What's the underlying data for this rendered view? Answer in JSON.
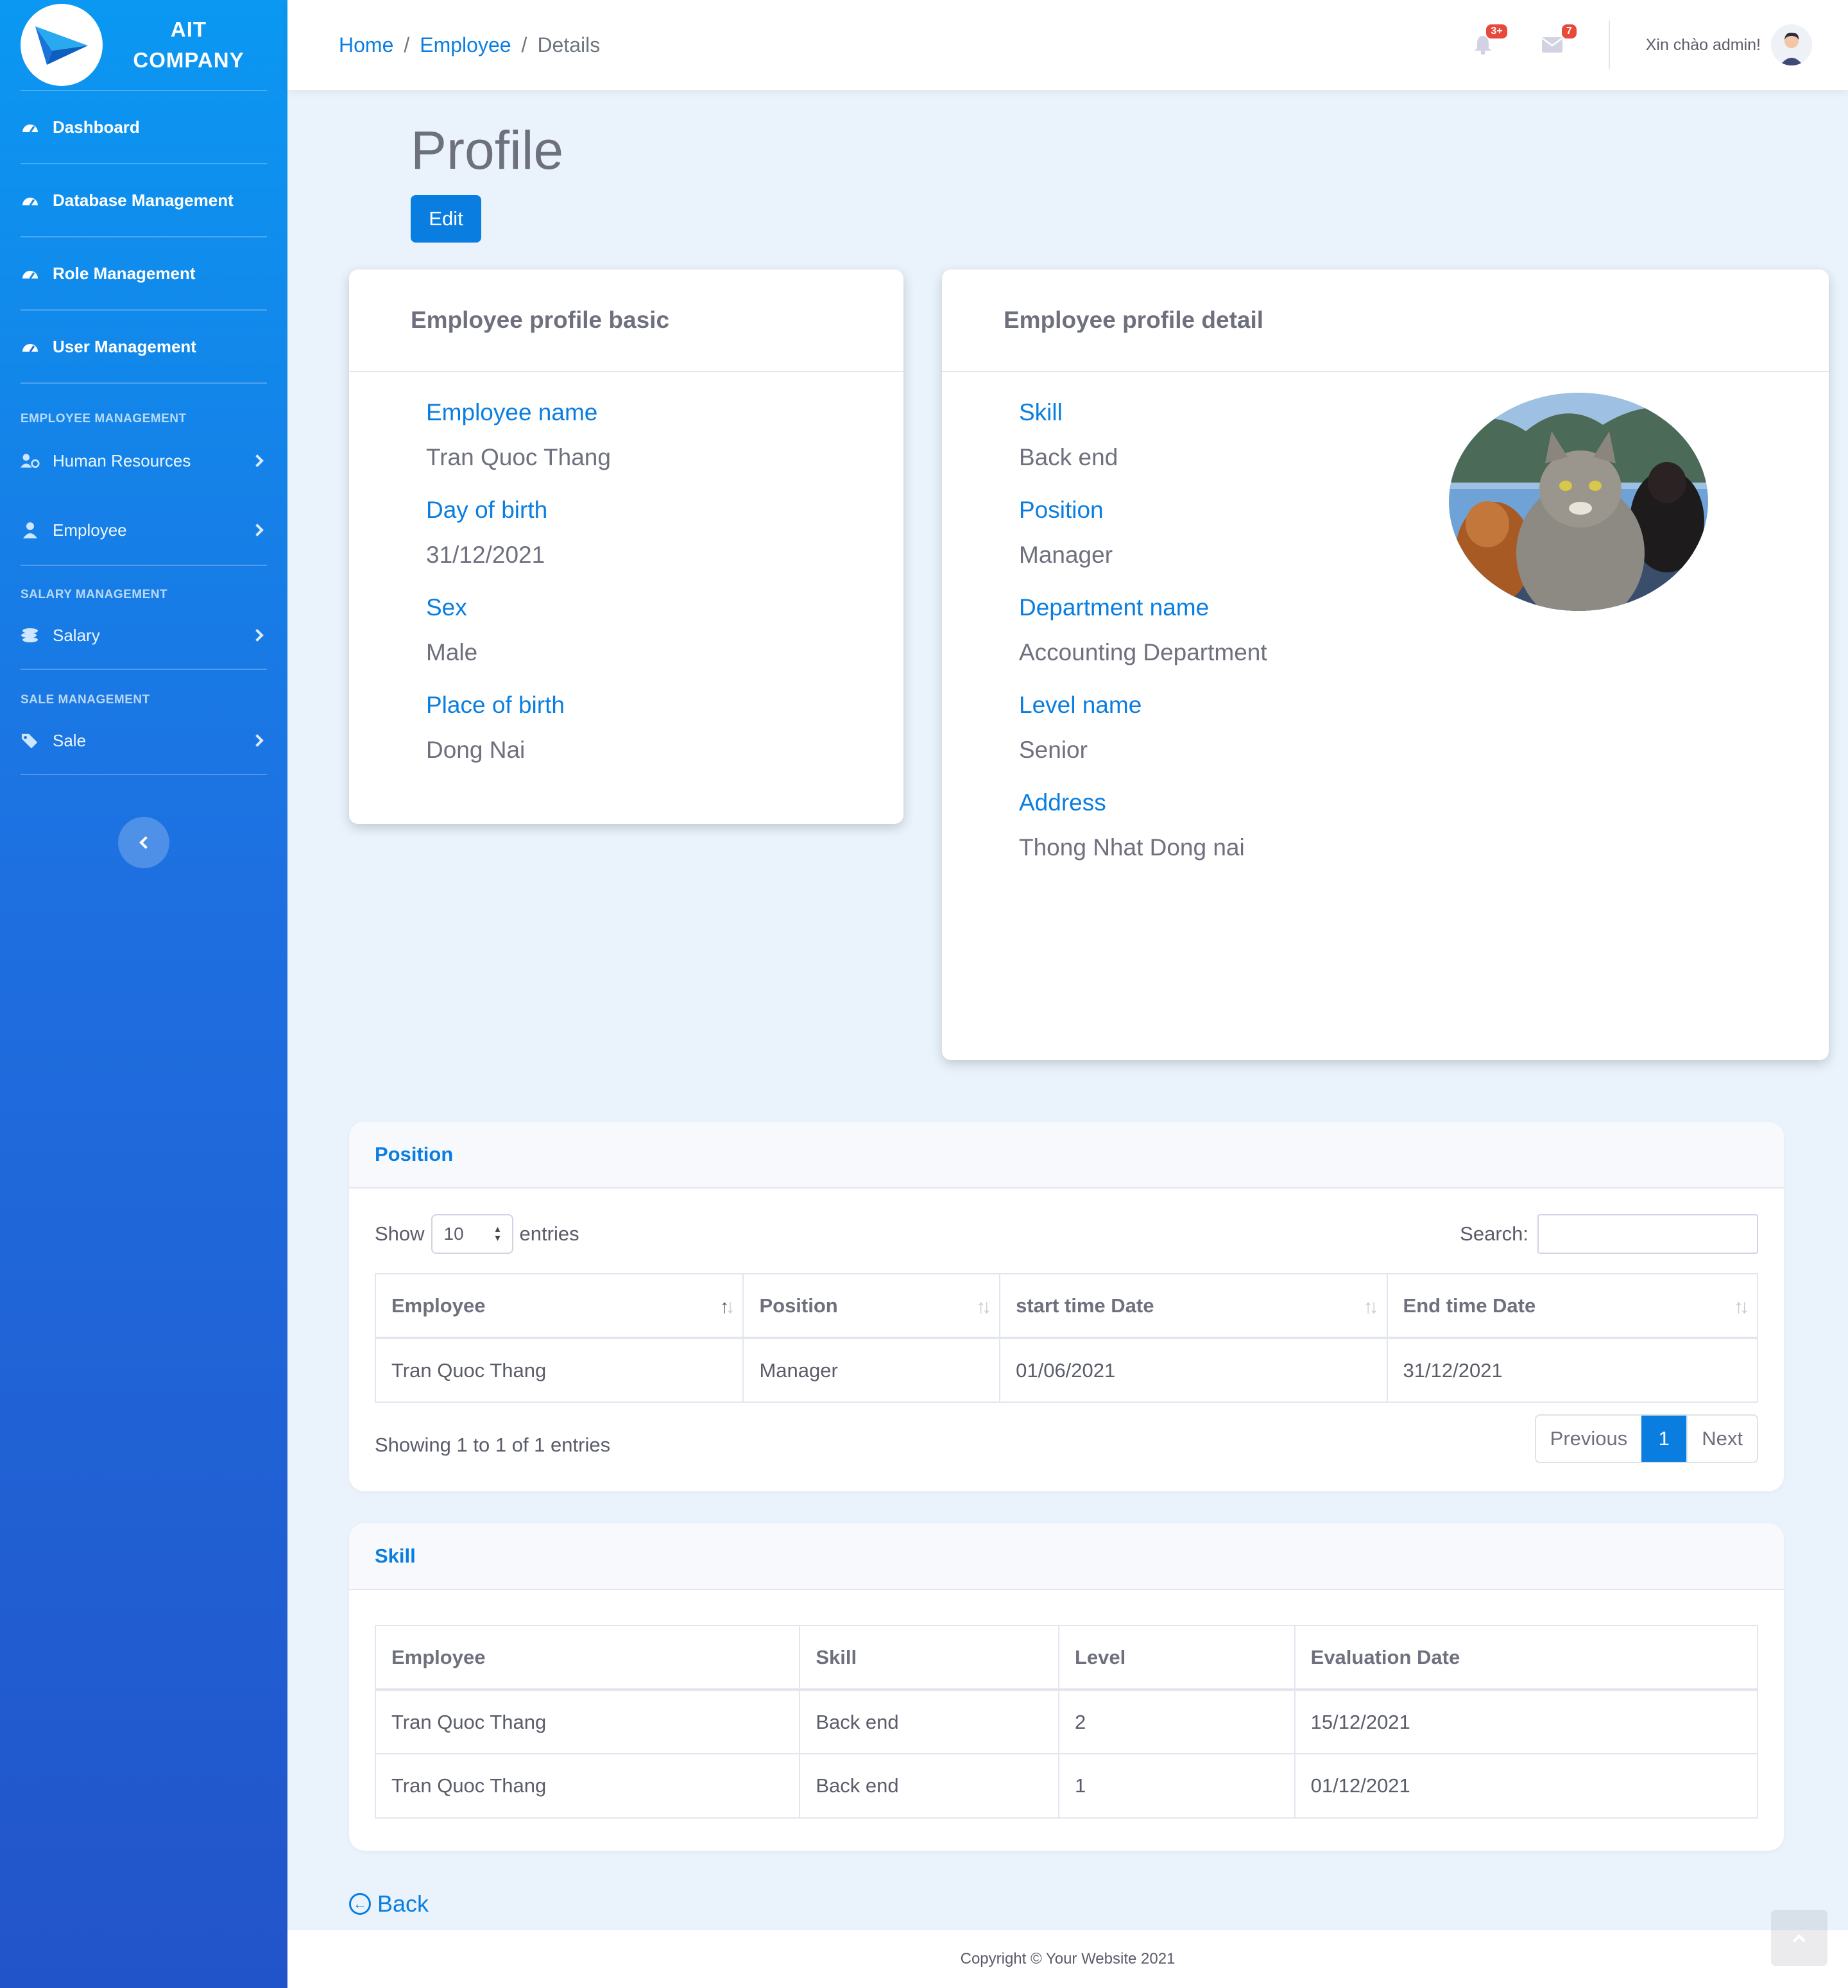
{
  "brand": {
    "line1": "AIT",
    "line2": "COMPANY"
  },
  "sidebar": {
    "main_items": [
      {
        "label": "Dashboard",
        "icon": "gauge-icon"
      },
      {
        "label": "Database Management",
        "icon": "gauge-icon"
      },
      {
        "label": "Role Management",
        "icon": "gauge-icon"
      },
      {
        "label": "User Management",
        "icon": "gauge-icon"
      }
    ],
    "sections": [
      {
        "heading": "EMPLOYEE MANAGEMENT",
        "items": [
          {
            "label": "Human Resources",
            "icon": "users-cog-icon"
          },
          {
            "label": "Employee",
            "icon": "user-icon"
          }
        ]
      },
      {
        "heading": "SALARY MANAGEMENT",
        "items": [
          {
            "label": "Salary",
            "icon": "coins-icon"
          }
        ]
      },
      {
        "heading": "SALE MANAGEMENT",
        "items": [
          {
            "label": "Sale",
            "icon": "tags-icon"
          }
        ]
      }
    ]
  },
  "topbar": {
    "breadcrumb": {
      "home": "Home",
      "employee": "Employee",
      "current": "Details",
      "separator": "/"
    },
    "alerts_badge": "3+",
    "messages_badge": "7",
    "greeting": "Xin chào admin!"
  },
  "page": {
    "title": "Profile",
    "edit_label": "Edit",
    "back_label": "Back"
  },
  "basic": {
    "title": "Employee profile basic",
    "fields": [
      {
        "label": "Employee name",
        "value": "Tran Quoc Thang"
      },
      {
        "label": "Day of birth",
        "value": "31/12/2021"
      },
      {
        "label": "Sex",
        "value": "Male"
      },
      {
        "label": "Place of birth",
        "value": "Dong Nai"
      }
    ]
  },
  "detail": {
    "title": "Employee profile detail",
    "fields": [
      {
        "label": "Skill",
        "value": "Back end"
      },
      {
        "label": "Position",
        "value": "Manager"
      },
      {
        "label": "Department name",
        "value": "Accounting Department"
      },
      {
        "label": "Level name",
        "value": "Senior"
      },
      {
        "label": "Address",
        "value": "Thong Nhat Dong nai"
      }
    ]
  },
  "position_table": {
    "title": "Position",
    "show_label": "Show",
    "page_size": "10",
    "entries_label": "entries",
    "search_label": "Search:",
    "columns": [
      "Employee",
      "Position",
      "start time Date",
      "End time Date"
    ],
    "rows": [
      [
        "Tran Quoc Thang",
        "Manager",
        "01/06/2021",
        "31/12/2021"
      ]
    ],
    "info": "Showing 1 to 1 of 1 entries",
    "pager": {
      "previous": "Previous",
      "current": "1",
      "next": "Next"
    }
  },
  "skill_table": {
    "title": "Skill",
    "columns": [
      "Employee",
      "Skill",
      "Level",
      "Evaluation Date"
    ],
    "rows": [
      [
        "Tran Quoc Thang",
        "Back end",
        "2",
        "15/12/2021"
      ],
      [
        "Tran Quoc Thang",
        "Back end",
        "1",
        "01/12/2021"
      ]
    ]
  },
  "footer": {
    "copyright": "Copyright © Your Website 2021"
  },
  "colors": {
    "primary": "#0a7ee0",
    "sidebar_top": "#0a98f2",
    "sidebar_bottom": "#2254c9",
    "danger": "#e74a3b"
  }
}
